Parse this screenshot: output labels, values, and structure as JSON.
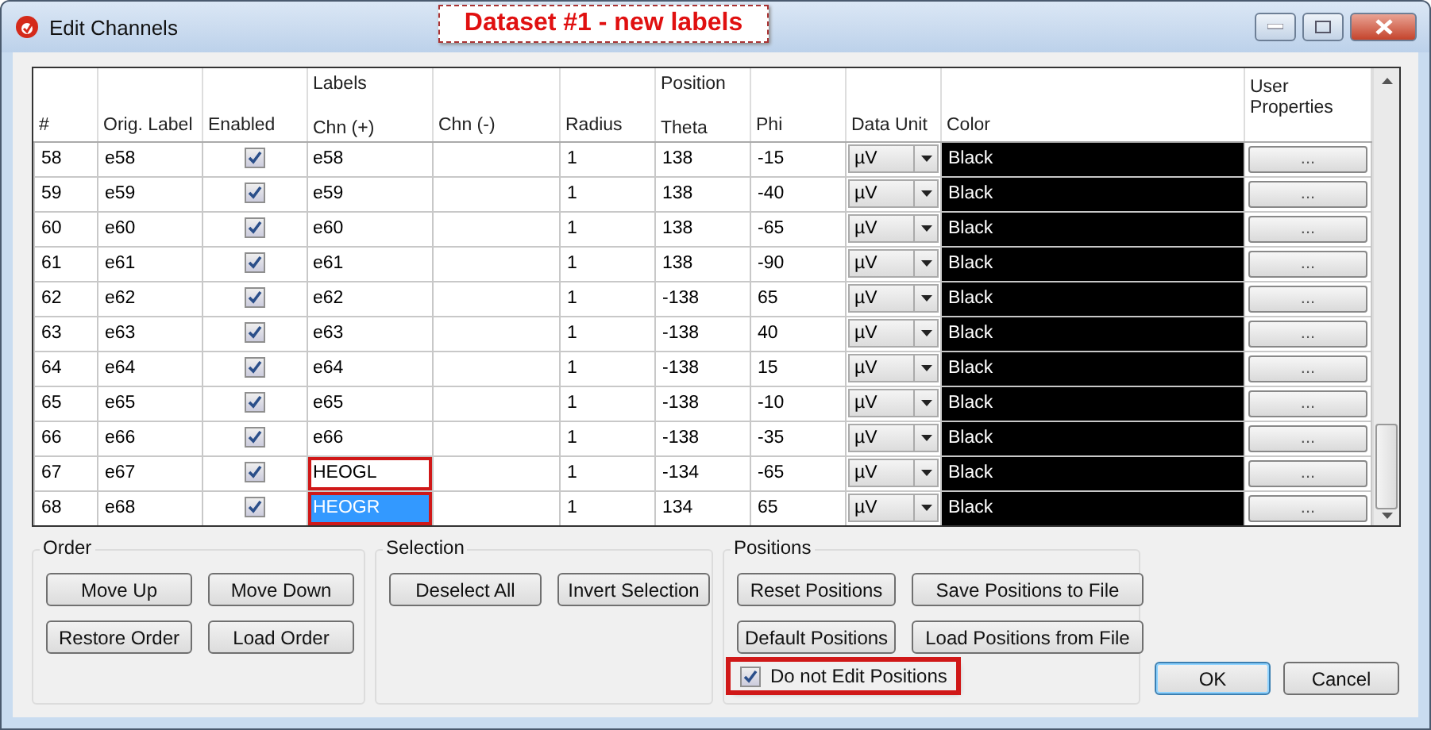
{
  "window": {
    "title": "Edit Channels"
  },
  "annotation": {
    "text": "Dataset #1 - new labels"
  },
  "table": {
    "columns": [
      {
        "label": "#"
      },
      {
        "label": "Orig. Label"
      },
      {
        "label": "Enabled"
      },
      {
        "group": "Labels",
        "label": "Chn (+)"
      },
      {
        "label": "Chn (-)"
      },
      {
        "label": "Radius"
      },
      {
        "group": "Position",
        "label": "Theta"
      },
      {
        "label": "Phi"
      },
      {
        "label": "Data Unit"
      },
      {
        "label": "Color"
      },
      {
        "group": "User Properties"
      }
    ],
    "rows": [
      {
        "num": "58",
        "orig": "e58",
        "enabled": true,
        "chn_plus": "e58",
        "selected": false,
        "highlighted": false,
        "radius": "1",
        "theta": "138",
        "phi": "-15",
        "unit": "µV",
        "color_name": "Black",
        "props": "..."
      },
      {
        "num": "59",
        "orig": "e59",
        "enabled": true,
        "chn_plus": "e59",
        "selected": false,
        "highlighted": false,
        "radius": "1",
        "theta": "138",
        "phi": "-40",
        "unit": "µV",
        "color_name": "Black",
        "props": "..."
      },
      {
        "num": "60",
        "orig": "e60",
        "enabled": true,
        "chn_plus": "e60",
        "selected": false,
        "highlighted": false,
        "radius": "1",
        "theta": "138",
        "phi": "-65",
        "unit": "µV",
        "color_name": "Black",
        "props": "..."
      },
      {
        "num": "61",
        "orig": "e61",
        "enabled": true,
        "chn_plus": "e61",
        "selected": false,
        "highlighted": false,
        "radius": "1",
        "theta": "138",
        "phi": "-90",
        "unit": "µV",
        "color_name": "Black",
        "props": "..."
      },
      {
        "num": "62",
        "orig": "e62",
        "enabled": true,
        "chn_plus": "e62",
        "selected": false,
        "highlighted": false,
        "radius": "1",
        "theta": "-138",
        "phi": "65",
        "unit": "µV",
        "color_name": "Black",
        "props": "..."
      },
      {
        "num": "63",
        "orig": "e63",
        "enabled": true,
        "chn_plus": "e63",
        "selected": false,
        "highlighted": false,
        "radius": "1",
        "theta": "-138",
        "phi": "40",
        "unit": "µV",
        "color_name": "Black",
        "props": "..."
      },
      {
        "num": "64",
        "orig": "e64",
        "enabled": true,
        "chn_plus": "e64",
        "selected": false,
        "highlighted": false,
        "radius": "1",
        "theta": "-138",
        "phi": "15",
        "unit": "µV",
        "color_name": "Black",
        "props": "..."
      },
      {
        "num": "65",
        "orig": "e65",
        "enabled": true,
        "chn_plus": "e65",
        "selected": false,
        "highlighted": false,
        "radius": "1",
        "theta": "-138",
        "phi": "-10",
        "unit": "µV",
        "color_name": "Black",
        "props": "..."
      },
      {
        "num": "66",
        "orig": "e66",
        "enabled": true,
        "chn_plus": "e66",
        "selected": false,
        "highlighted": false,
        "radius": "1",
        "theta": "-138",
        "phi": "-35",
        "unit": "µV",
        "color_name": "Black",
        "props": "..."
      },
      {
        "num": "67",
        "orig": "e67",
        "enabled": true,
        "chn_plus": "HEOGL",
        "selected": false,
        "highlighted": true,
        "radius": "1",
        "theta": "-134",
        "phi": "-65",
        "unit": "µV",
        "color_name": "Black",
        "props": "..."
      },
      {
        "num": "68",
        "orig": "e68",
        "enabled": true,
        "chn_plus": "HEOGR",
        "selected": true,
        "highlighted": true,
        "radius": "1",
        "theta": "134",
        "phi": "65",
        "unit": "µV",
        "color_name": "Black",
        "props": "..."
      }
    ]
  },
  "groups": [
    {
      "title": "Order",
      "buttons": [
        "Move Up",
        "Move Down",
        "Restore Order",
        "Load Order"
      ]
    },
    {
      "title": "Selection",
      "buttons": [
        "Deselect All",
        "Invert Selection"
      ]
    },
    {
      "title": "Positions",
      "buttons": [
        "Reset Positions",
        "Save Positions to File",
        "Default Positions",
        "Load Positions from File"
      ],
      "checkbox": {
        "label": "Do not Edit Positions",
        "checked": true,
        "highlighted": true
      }
    }
  ],
  "dialog_buttons": [
    {
      "label": "OK",
      "default": true
    },
    {
      "label": "Cancel",
      "default": false
    }
  ]
}
